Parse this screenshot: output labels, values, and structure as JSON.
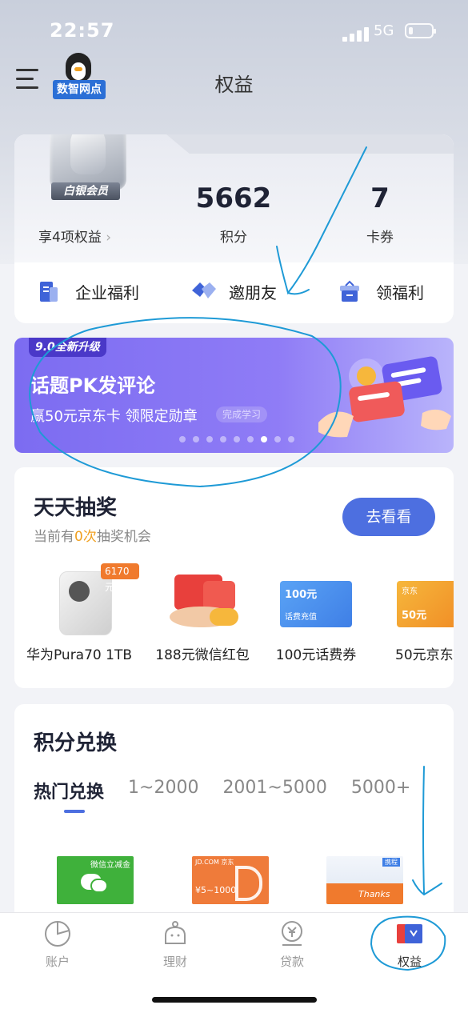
{
  "status": {
    "time": "22:57",
    "network": "5G"
  },
  "header": {
    "title": "权益",
    "logo_text": "数智网点"
  },
  "member": {
    "level": "白银会员",
    "rights_label": "享4项权益",
    "points_value": "5662",
    "points_label": "积分",
    "coupons_value": "7",
    "coupons_label": "卡券"
  },
  "quick_links": [
    {
      "label": "企业福利",
      "icon": "building-icon"
    },
    {
      "label": "邀朋友",
      "icon": "handshake-icon"
    },
    {
      "label": "领福利",
      "icon": "gift-icon"
    }
  ],
  "banner": {
    "tag": "9.0全新升级",
    "title": "话题PK发评论",
    "subtitle": "赢50元京东卡  领限定勋章",
    "pill": "完成学习",
    "dots": 8,
    "active_dot": 6
  },
  "lottery": {
    "title": "天天抽奖",
    "subtitle_prefix": "当前有",
    "count": "0",
    "subtitle_unit": "次",
    "subtitle_suffix": "抽奖机会",
    "button": "去看看",
    "prizes": [
      {
        "label": "华为Pura70 1TB",
        "badge": "6170元"
      },
      {
        "label": "188元微信红包"
      },
      {
        "label": "100元话费券",
        "card_text": "100元",
        "card_sub": "话费充值"
      },
      {
        "label": "50元京东",
        "card_text": "50元",
        "card_brand": "京东"
      }
    ]
  },
  "points_exchange": {
    "title": "积分兑换",
    "tabs": [
      "热门兑换",
      "1~2000",
      "2001~5000",
      "5000+"
    ],
    "active_tab": 0,
    "gift_cards": [
      {
        "text": "微信立减金",
        "color": "#3fb13b"
      },
      {
        "text": "JD.COM 京东",
        "sub": "¥5~1000",
        "color": "#ef7b3a"
      },
      {
        "text": "Thanks",
        "tag": "携程",
        "color": "#e9eef6"
      }
    ]
  },
  "bottom_nav": [
    {
      "label": "账户",
      "icon": "pie-chart-icon"
    },
    {
      "label": "理财",
      "icon": "piggy-bank-icon"
    },
    {
      "label": "贷款",
      "icon": "yuan-coin-icon"
    },
    {
      "label": "权益",
      "icon": "rights-icon",
      "active": true
    }
  ],
  "colors": {
    "accent": "#4d6fe0",
    "annotation": "#1e9ad6",
    "banner": "#8f7cf6"
  }
}
